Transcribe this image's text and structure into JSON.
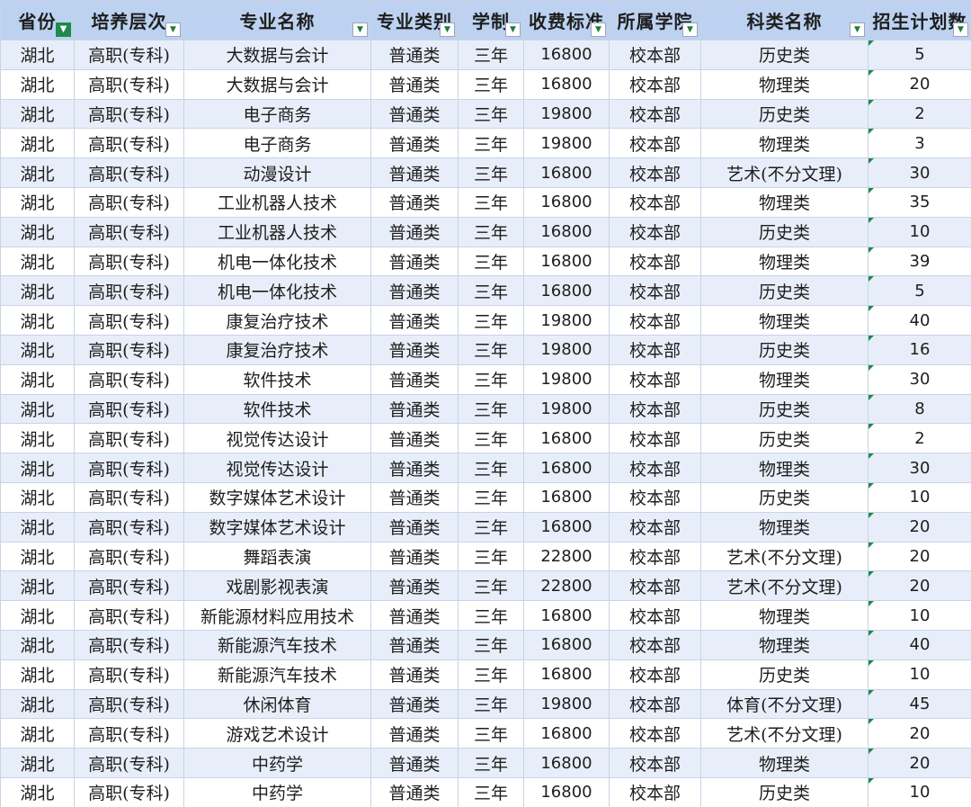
{
  "headers": [
    "省份",
    "培养层次",
    "专业名称",
    "专业类别",
    "学制",
    "收费标准",
    "所属学院",
    "科类名称",
    "招生计划数"
  ],
  "filter_icon": "filter-active-icon",
  "dropdown_icon": "dropdown-arrow-icon",
  "rows": [
    [
      "湖北",
      "高职(专科)",
      "大数据与会计",
      "普通类",
      "三年",
      "16800",
      "校本部",
      "历史类",
      "5"
    ],
    [
      "湖北",
      "高职(专科)",
      "大数据与会计",
      "普通类",
      "三年",
      "16800",
      "校本部",
      "物理类",
      "20"
    ],
    [
      "湖北",
      "高职(专科)",
      "电子商务",
      "普通类",
      "三年",
      "19800",
      "校本部",
      "历史类",
      "2"
    ],
    [
      "湖北",
      "高职(专科)",
      "电子商务",
      "普通类",
      "三年",
      "19800",
      "校本部",
      "物理类",
      "3"
    ],
    [
      "湖北",
      "高职(专科)",
      "动漫设计",
      "普通类",
      "三年",
      "16800",
      "校本部",
      "艺术(不分文理)",
      "30"
    ],
    [
      "湖北",
      "高职(专科)",
      "工业机器人技术",
      "普通类",
      "三年",
      "16800",
      "校本部",
      "物理类",
      "35"
    ],
    [
      "湖北",
      "高职(专科)",
      "工业机器人技术",
      "普通类",
      "三年",
      "16800",
      "校本部",
      "历史类",
      "10"
    ],
    [
      "湖北",
      "高职(专科)",
      "机电一体化技术",
      "普通类",
      "三年",
      "16800",
      "校本部",
      "物理类",
      "39"
    ],
    [
      "湖北",
      "高职(专科)",
      "机电一体化技术",
      "普通类",
      "三年",
      "16800",
      "校本部",
      "历史类",
      "5"
    ],
    [
      "湖北",
      "高职(专科)",
      "康复治疗技术",
      "普通类",
      "三年",
      "19800",
      "校本部",
      "物理类",
      "40"
    ],
    [
      "湖北",
      "高职(专科)",
      "康复治疗技术",
      "普通类",
      "三年",
      "19800",
      "校本部",
      "历史类",
      "16"
    ],
    [
      "湖北",
      "高职(专科)",
      "软件技术",
      "普通类",
      "三年",
      "19800",
      "校本部",
      "物理类",
      "30"
    ],
    [
      "湖北",
      "高职(专科)",
      "软件技术",
      "普通类",
      "三年",
      "19800",
      "校本部",
      "历史类",
      "8"
    ],
    [
      "湖北",
      "高职(专科)",
      "视觉传达设计",
      "普通类",
      "三年",
      "16800",
      "校本部",
      "历史类",
      "2"
    ],
    [
      "湖北",
      "高职(专科)",
      "视觉传达设计",
      "普通类",
      "三年",
      "16800",
      "校本部",
      "物理类",
      "30"
    ],
    [
      "湖北",
      "高职(专科)",
      "数字媒体艺术设计",
      "普通类",
      "三年",
      "16800",
      "校本部",
      "历史类",
      "10"
    ],
    [
      "湖北",
      "高职(专科)",
      "数字媒体艺术设计",
      "普通类",
      "三年",
      "16800",
      "校本部",
      "物理类",
      "20"
    ],
    [
      "湖北",
      "高职(专科)",
      "舞蹈表演",
      "普通类",
      "三年",
      "22800",
      "校本部",
      "艺术(不分文理)",
      "20"
    ],
    [
      "湖北",
      "高职(专科)",
      "戏剧影视表演",
      "普通类",
      "三年",
      "22800",
      "校本部",
      "艺术(不分文理)",
      "20"
    ],
    [
      "湖北",
      "高职(专科)",
      "新能源材料应用技术",
      "普通类",
      "三年",
      "16800",
      "校本部",
      "物理类",
      "10"
    ],
    [
      "湖北",
      "高职(专科)",
      "新能源汽车技术",
      "普通类",
      "三年",
      "16800",
      "校本部",
      "物理类",
      "40"
    ],
    [
      "湖北",
      "高职(专科)",
      "新能源汽车技术",
      "普通类",
      "三年",
      "16800",
      "校本部",
      "历史类",
      "10"
    ],
    [
      "湖北",
      "高职(专科)",
      "休闲体育",
      "普通类",
      "三年",
      "19800",
      "校本部",
      "体育(不分文理)",
      "45"
    ],
    [
      "湖北",
      "高职(专科)",
      "游戏艺术设计",
      "普通类",
      "三年",
      "16800",
      "校本部",
      "艺术(不分文理)",
      "20"
    ],
    [
      "湖北",
      "高职(专科)",
      "中药学",
      "普通类",
      "三年",
      "16800",
      "校本部",
      "物理类",
      "20"
    ],
    [
      "湖北",
      "高职(专科)",
      "中药学",
      "普通类",
      "三年",
      "16800",
      "校本部",
      "历史类",
      "10"
    ]
  ]
}
